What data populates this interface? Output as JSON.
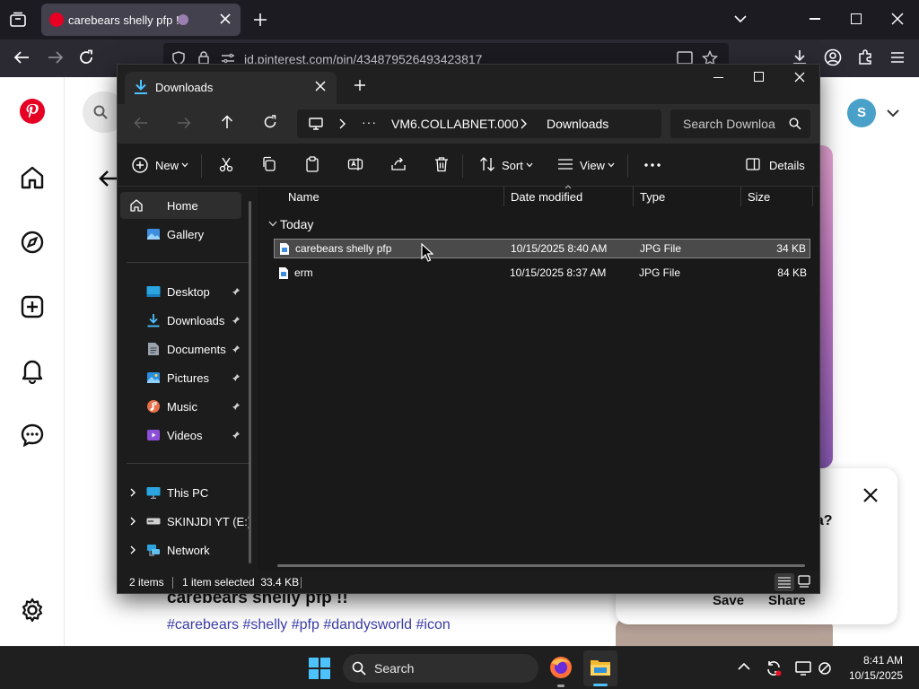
{
  "browser": {
    "tab_title": "carebears shelly pfp !!",
    "url": "id.pinterest.com/pin/434879526493423817"
  },
  "pinterest": {
    "avatar_letter": "S",
    "pin_title": "carebears shelly pfp !!",
    "pin_tags": "#carebears #shelly #pfp #dandysworld #icon",
    "popup_text": "ea?",
    "save_label": "Save",
    "share_label": "Share"
  },
  "explorer": {
    "tab_title": "Downloads",
    "breadcrumb": [
      "VM6.COLLABNET.000",
      "Downloads"
    ],
    "search_placeholder": "Search Downloa",
    "toolbar": {
      "new_label": "New",
      "sort_label": "Sort",
      "view_label": "View",
      "details_label": "Details"
    },
    "nav_items": [
      {
        "label": "Home",
        "icon": "home-icon"
      },
      {
        "label": "Gallery",
        "icon": "gallery-icon"
      },
      {
        "label": "Desktop",
        "icon": "desktop-icon",
        "pinned": true
      },
      {
        "label": "Downloads",
        "icon": "download-icon",
        "pinned": true
      },
      {
        "label": "Documents",
        "icon": "documents-icon",
        "pinned": true
      },
      {
        "label": "Pictures",
        "icon": "pictures-icon",
        "pinned": true
      },
      {
        "label": "Music",
        "icon": "music-icon",
        "pinned": true
      },
      {
        "label": "Videos",
        "icon": "videos-icon",
        "pinned": true
      },
      {
        "label": "This PC",
        "icon": "computer-icon"
      },
      {
        "label": "SKINJDI YT (E:)",
        "icon": "drive-icon"
      },
      {
        "label": "Network",
        "icon": "network-icon"
      }
    ],
    "columns": [
      "Name",
      "Date modified",
      "Type",
      "Size"
    ],
    "group_label": "Today",
    "files": [
      {
        "name": "carebears shelly pfp",
        "date": "10/15/2025 8:40 AM",
        "type": "JPG File",
        "size": "34 KB"
      },
      {
        "name": "erm",
        "date": "10/15/2025 8:37 AM",
        "type": "JPG File",
        "size": "84 KB"
      }
    ],
    "status": {
      "items": "2 items",
      "selected": "1 item selected  33.4 KB"
    }
  },
  "taskbar": {
    "search_label": "Search",
    "time": "8:41 AM",
    "date": "10/15/2025"
  },
  "colors": {
    "pinterest_red": "#e60023",
    "selection": "#4a4a4a",
    "download_accent": "#4cc2ff"
  }
}
